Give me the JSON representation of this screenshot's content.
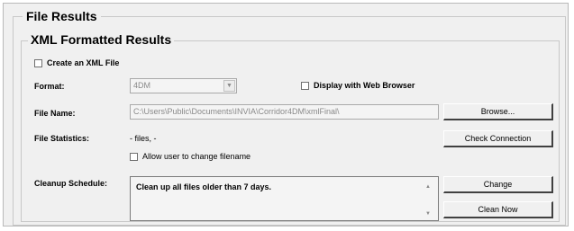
{
  "file_results": {
    "title": "File Results"
  },
  "xml_results": {
    "title": "XML Formatted Results",
    "create_xml_label": "Create an XML File",
    "format_label": "Format:",
    "format_value": "4DM",
    "display_browser_label": "Display with Web Browser",
    "file_name_label": "File Name:",
    "file_name_value": "C:\\Users\\Public\\Documents\\INVIA\\Corridor4DM\\xmlFinal\\",
    "browse_label": "Browse...",
    "file_stats_label": "File Statistics:",
    "file_stats_value": "-   files,  -",
    "check_connection_label": "Check Connection",
    "allow_change_label": "Allow user to change filename",
    "cleanup_label": "Cleanup Schedule:",
    "cleanup_text": "Clean up all files older than 7 days.",
    "change_label": "Change",
    "clean_now_label": "Clean Now"
  }
}
